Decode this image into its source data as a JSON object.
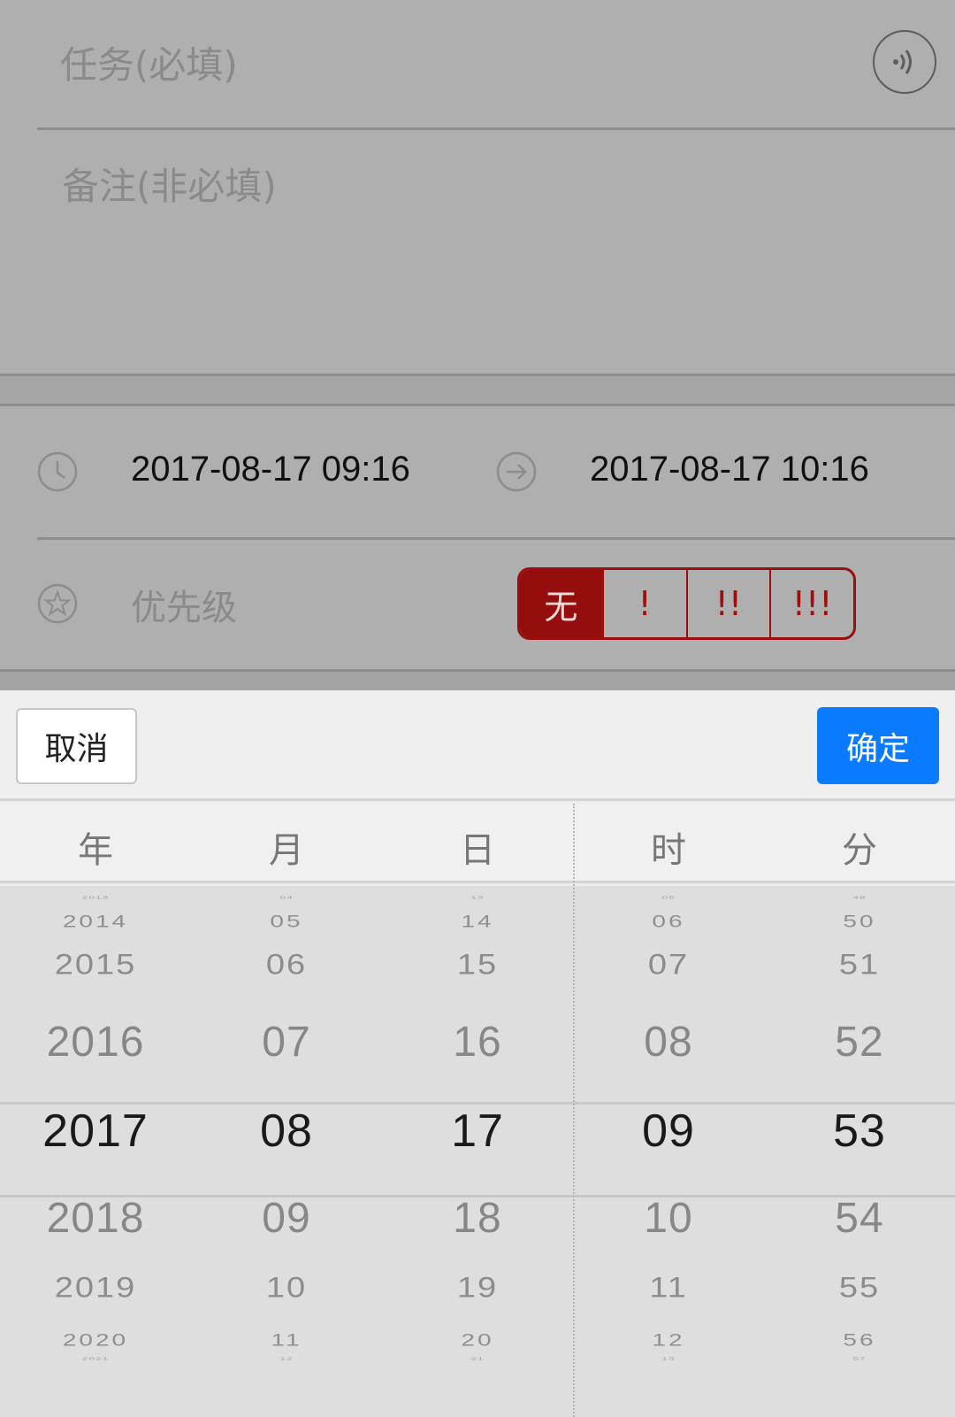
{
  "form": {
    "task_placeholder": "任务(必填)",
    "note_placeholder": "备注(非必填)",
    "start_time": "2017-08-17 09:16",
    "end_time": "2017-08-17 10:16",
    "priority_label": "优先级",
    "priority_options": [
      "无",
      "!",
      "!!",
      "!!!"
    ],
    "priority_selected": "无",
    "accent_color": "#960d0d"
  },
  "picker": {
    "cancel_label": "取消",
    "confirm_label": "确定",
    "confirm_color": "#0a7bff",
    "columns": [
      {
        "title": "年",
        "values": [
          "2013",
          "2014",
          "2015",
          "2016",
          "2017",
          "2018",
          "2019",
          "2020",
          "2021"
        ],
        "selected": "2017"
      },
      {
        "title": "月",
        "values": [
          "04",
          "05",
          "06",
          "07",
          "08",
          "09",
          "10",
          "11",
          "12"
        ],
        "selected": "08"
      },
      {
        "title": "日",
        "values": [
          "13",
          "14",
          "15",
          "16",
          "17",
          "18",
          "19",
          "20",
          "21"
        ],
        "selected": "17"
      },
      {
        "title": "时",
        "values": [
          "05",
          "06",
          "07",
          "08",
          "09",
          "10",
          "11",
          "12",
          "13"
        ],
        "selected": "09"
      },
      {
        "title": "分",
        "values": [
          "49",
          "50",
          "51",
          "52",
          "53",
          "54",
          "55",
          "56",
          "57"
        ],
        "selected": "53"
      }
    ]
  }
}
